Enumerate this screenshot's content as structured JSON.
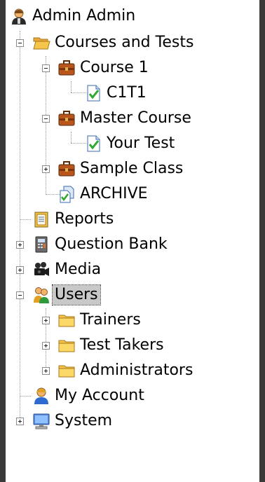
{
  "tree": {
    "root": {
      "label": "Admin Admin",
      "icon": "admin-user-icon"
    },
    "items": [
      {
        "label": "Courses and Tests",
        "icon": "open-folder-icon",
        "state": "expanded"
      },
      {
        "label": "Course 1",
        "icon": "briefcase-icon",
        "state": "expanded"
      },
      {
        "label": "C1T1",
        "icon": "test-document-icon"
      },
      {
        "label": "Master Course",
        "icon": "briefcase-icon",
        "state": "expanded"
      },
      {
        "label": "Your Test",
        "icon": "test-document-icon"
      },
      {
        "label": "Sample Class",
        "icon": "briefcase-icon",
        "state": "collapsed"
      },
      {
        "label": "ARCHIVE",
        "icon": "archive-icon"
      },
      {
        "label": "Reports",
        "icon": "report-icon"
      },
      {
        "label": "Question Bank",
        "icon": "question-bank-icon",
        "state": "collapsed"
      },
      {
        "label": "Media",
        "icon": "camera-icon",
        "state": "collapsed"
      },
      {
        "label": "Users",
        "icon": "users-icon",
        "state": "expanded",
        "selected": true
      },
      {
        "label": "Trainers",
        "icon": "folder-icon",
        "state": "collapsed"
      },
      {
        "label": "Test Takers",
        "icon": "folder-icon",
        "state": "collapsed"
      },
      {
        "label": "Administrators",
        "icon": "folder-icon",
        "state": "collapsed"
      },
      {
        "label": "My Account",
        "icon": "my-account-icon"
      },
      {
        "label": "System",
        "icon": "computer-icon",
        "state": "collapsed"
      }
    ]
  },
  "colors": {
    "background": "#3a3a38",
    "selection": "#c8c8c8",
    "folder": "#f6c64a",
    "briefcase": "#b8561d"
  }
}
